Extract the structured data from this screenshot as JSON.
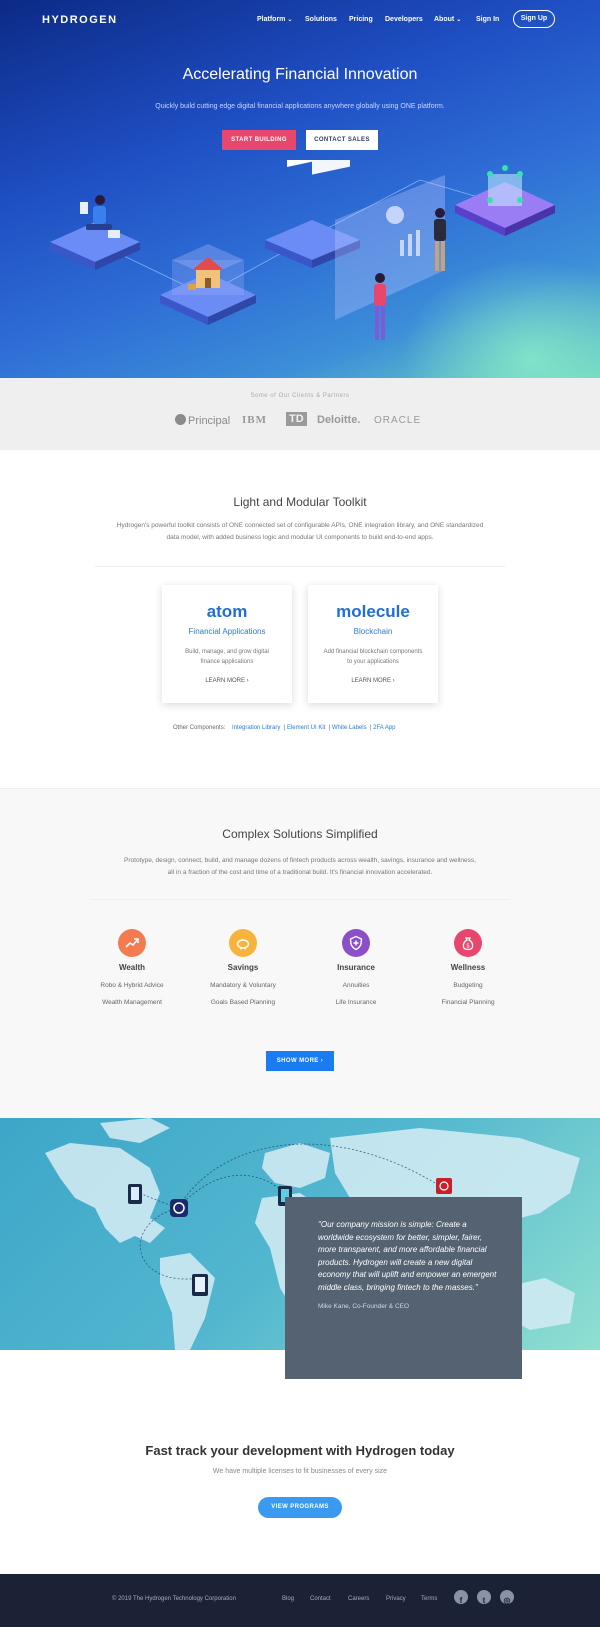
{
  "nav": {
    "logo": "HYDROGEN",
    "items": [
      {
        "label": "Platform",
        "has_dropdown": true
      },
      {
        "label": "Solutions",
        "has_dropdown": false
      },
      {
        "label": "Pricing",
        "has_dropdown": false
      },
      {
        "label": "Developers",
        "has_dropdown": false
      },
      {
        "label": "About",
        "has_dropdown": true
      },
      {
        "label": "Sign In",
        "has_dropdown": false
      }
    ],
    "signup": "Sign Up"
  },
  "hero": {
    "title": "Accelerating Financial Innovation",
    "subtitle": "Quickly build cutting edge digital financial applications anywhere globally using ONE platform.",
    "primary_button": "START BUILDING",
    "secondary_button": "CONTACT SALES"
  },
  "clients": {
    "label": "Some of Our Clients & Partners",
    "logos": [
      "Principal",
      "IBM",
      "TD",
      "Deloitte.",
      "ORACLE"
    ]
  },
  "toolkit": {
    "title": "Light and Modular Toolkit",
    "description": "Hydrogen's powerful toolkit consists of ONE connected set of configurable APIs, ONE integration library, and ONE standardized data model, with added business logic and modular UI components to build end-to-end apps.",
    "cards": [
      {
        "logo": "atom",
        "subtitle": "Financial Applications",
        "description": "Build, manage, and grow digital finance applications",
        "link": "LEARN MORE"
      },
      {
        "logo": "molecule",
        "subtitle": "Blockchain",
        "description": "Add financial blockchain components to your applications",
        "link": "LEARN MORE"
      }
    ],
    "other_label": "Other Components:",
    "other_links": [
      "Integration Library",
      "Element UI Kit",
      "White Labels",
      "2FA App"
    ]
  },
  "solutions": {
    "title": "Complex Solutions Simplified",
    "description": "Prototype, design, connect, build, and manage dozens of fintech products across wealth, savings, insurance and wellness, all in a fraction of the cost and time of a traditional build. It's financial innovation accelerated.",
    "columns": [
      {
        "name": "Wealth",
        "icon": "chart-up-icon",
        "color": "#f47b4f",
        "items": [
          "Robo & Hybrid Advice",
          "Wealth Management"
        ]
      },
      {
        "name": "Savings",
        "icon": "piggy-bank-icon",
        "color": "#f7b43c",
        "items": [
          "Mandatory & Voluntary",
          "Goals Based Planning"
        ]
      },
      {
        "name": "Insurance",
        "icon": "shield-icon",
        "color": "#8a4fc9",
        "items": [
          "Annuities",
          "Life Insurance"
        ]
      },
      {
        "name": "Wellness",
        "icon": "money-bag-icon",
        "color": "#e8476d",
        "items": [
          "Budgeting",
          "Financial Planning"
        ]
      }
    ],
    "button": "SHOW MORE"
  },
  "quote": {
    "text": "\"Our company mission is simple: Create a worldwide ecosystem for better, simpler, fairer, more transparent, and more affordable financial products. Hydrogen will create a new digital economy that will uplift and empower an emergent middle class, bringing fintech to the masses.\"",
    "author": "Mike Kane, Co-Founder & CEO"
  },
  "cta": {
    "title": "Fast track your development with Hydrogen today",
    "subtitle": "We have multiple licenses to fit businesses of every size",
    "button": "VIEW PROGRAMS"
  },
  "footer": {
    "copyright": "© 2019 The Hydrogen Technology Corporation",
    "links": [
      "Blog",
      "Contact",
      "Careers",
      "Privacy",
      "Terms"
    ],
    "social": [
      "facebook-icon",
      "twitter-icon",
      "instagram-icon"
    ]
  }
}
